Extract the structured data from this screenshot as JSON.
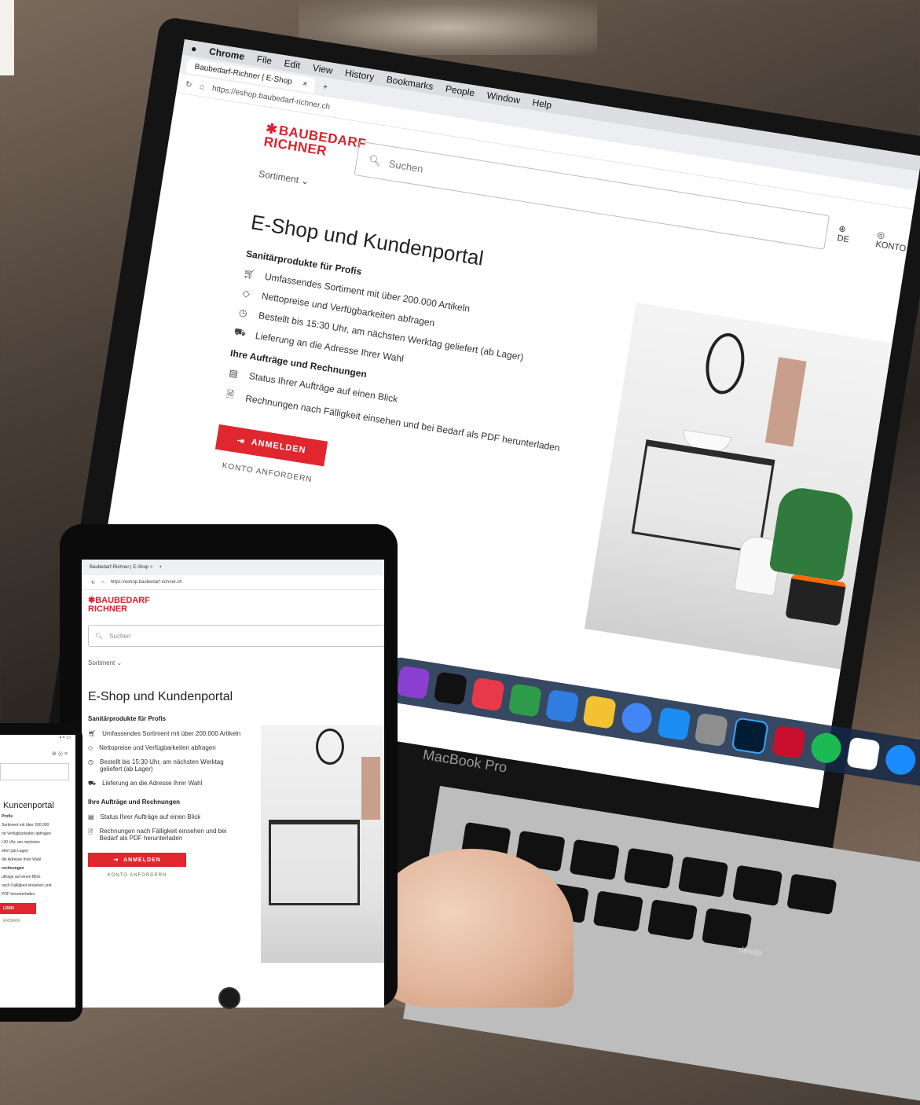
{
  "laptop": {
    "menubar": [
      "Chrome",
      "File",
      "Edit",
      "View",
      "History",
      "Bookmarks",
      "People",
      "Window",
      "Help"
    ],
    "tab_title": "Baubedarf-Richner | E-Shop",
    "url": "https://eshop.baubedarf-richner.ch",
    "logo_line1": "BAUBEDARF",
    "logo_line2": "RICHNER",
    "search_placeholder": "Suchen",
    "lang": "DE",
    "konto": "KONTO",
    "sortiment": "Sortiment",
    "title": "E-Shop und Kundenportal",
    "section1": "Sanitärprodukte für Profis",
    "features1": [
      {
        "icon": "cart-icon",
        "text": "Umfassendes Sortiment mit über 200.000 Artikeln"
      },
      {
        "icon": "tag-icon",
        "text": "Nettopreise und Verfügbarkeiten abfragen"
      },
      {
        "icon": "clock-icon",
        "text": "Bestellt bis 15:30 Uhr, am nächsten Werktag geliefert (ab Lager)"
      },
      {
        "icon": "truck-icon",
        "text": "Lieferung an die Adresse Ihrer Wahl"
      }
    ],
    "section2": "Ihre Aufträge und Rechnungen",
    "features2": [
      {
        "icon": "orders-icon",
        "text": "Status Ihrer Aufträge auf einen Blick"
      },
      {
        "icon": "invoice-icon",
        "text": "Rechnungen nach Fälligkeit einsehen und bei Bedarf als PDF herunterladen"
      }
    ],
    "login_button": "ANMELDEN",
    "request_account": "KONTO ANFORDERN",
    "macbook_label": "MacBook Pro",
    "delete_key": "delete"
  },
  "tablet": {
    "tab_title": "Baubedarf-Richner | E-Shop",
    "url": "https://eshop.baubedarf-richner.ch",
    "logo_line1": "BAUBEDARF",
    "logo_line2": "RICHNER",
    "search_placeholder": "Suchen",
    "sortiment": "Sortiment",
    "title": "E-Shop und Kundenportal",
    "section1": "Sanitärprodukte für Profis",
    "features1": [
      "Umfassendes Sortiment mit über 200.000 Artikeln",
      "Nettopreise und Verfügbarkeiten abfragen",
      "Bestellt bis 15:30 Uhr, am nächsten Werktag geliefert (ab Lager)",
      "Lieferung an die Adresse Ihrer Wahl"
    ],
    "section2": "Ihre Aufträge und Rechnungen",
    "features2": [
      "Status Ihrer Aufträge auf einen Blick",
      "Rechnungen nach Fälligkeit einsehen und bei Bedarf als PDF herunterladen"
    ],
    "login_button": "ANMELDEN",
    "request_account": "KONTO ANFORDERN"
  },
  "phone": {
    "title": "Kuncenportal",
    "texts": [
      "Profis",
      "Sortiment mit über 200.000",
      "nd Verfügbarkeiten abfragen",
      "l:30 Uhr, am nächsten",
      "efert (ab Lager)",
      "die Adresse Ihrer Wahl",
      "rechnungen",
      "ufträge auf einen Blick",
      "nach Fälligkeit einsehen und",
      "PDF herunterladen"
    ],
    "login_button": "LDEN",
    "request_account": "ERDERN"
  }
}
